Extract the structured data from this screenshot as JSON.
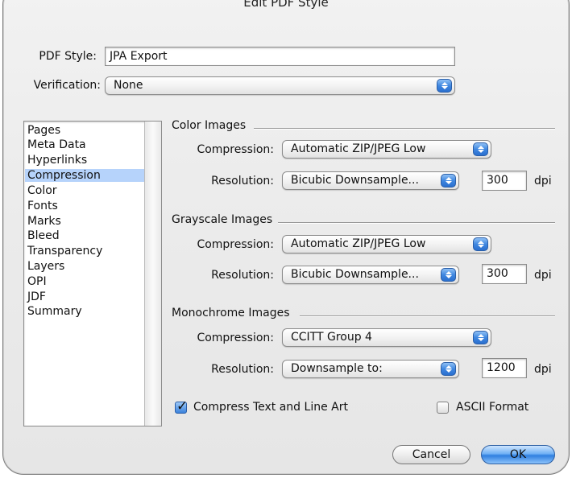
{
  "dialog": {
    "title": "Edit PDF Style"
  },
  "pdf_style": {
    "label": "PDF Style:",
    "value": "JPA Export"
  },
  "verification": {
    "label": "Verification:",
    "value": "None"
  },
  "sidebar": {
    "items": [
      {
        "label": "Pages"
      },
      {
        "label": "Meta Data"
      },
      {
        "label": "Hyperlinks"
      },
      {
        "label": "Compression",
        "selected": true
      },
      {
        "label": "Color"
      },
      {
        "label": "Fonts"
      },
      {
        "label": "Marks"
      },
      {
        "label": "Bleed"
      },
      {
        "label": "Transparency"
      },
      {
        "label": "Layers"
      },
      {
        "label": "OPI"
      },
      {
        "label": "JDF"
      },
      {
        "label": "Summary"
      }
    ]
  },
  "color_images": {
    "title": "Color Images",
    "compression_label": "Compression:",
    "compression_value": "Automatic ZIP/JPEG Low",
    "resolution_label": "Resolution:",
    "resolution_value": "Bicubic Downsample...",
    "dpi_value": "300",
    "dpi_unit": "dpi"
  },
  "grayscale_images": {
    "title": "Grayscale Images",
    "compression_label": "Compression:",
    "compression_value": "Automatic ZIP/JPEG Low",
    "resolution_label": "Resolution:",
    "resolution_value": "Bicubic Downsample...",
    "dpi_value": "300",
    "dpi_unit": "dpi"
  },
  "monochrome_images": {
    "title": "Monochrome Images",
    "compression_label": "Compression:",
    "compression_value": "CCITT Group 4",
    "resolution_label": "Resolution:",
    "resolution_value": "Downsample to:",
    "dpi_value": "1200",
    "dpi_unit": "dpi"
  },
  "options": {
    "compress_text": {
      "label": "Compress Text and Line Art",
      "checked": true
    },
    "ascii_format": {
      "label": "ASCII Format",
      "checked": false
    }
  },
  "buttons": {
    "cancel": "Cancel",
    "ok": "OK"
  },
  "colors": {
    "accent": "#3f87e0",
    "selection": "#b6d3fb"
  }
}
